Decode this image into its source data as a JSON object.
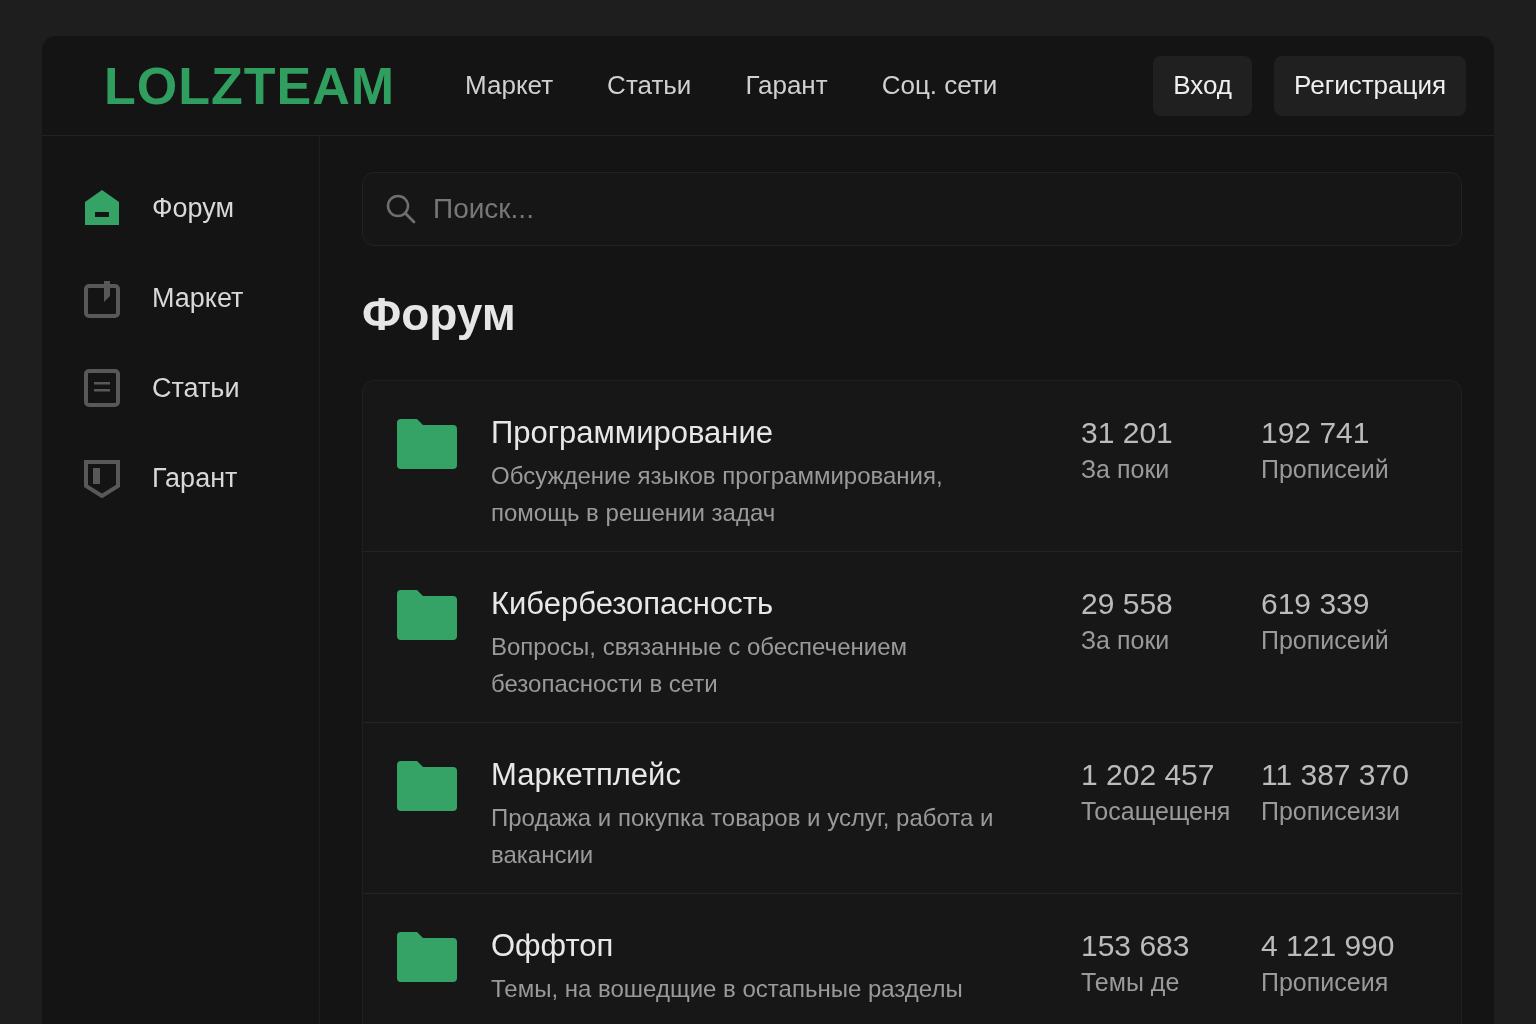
{
  "header": {
    "logo": "LOLZTEAM",
    "nav": [
      {
        "label": "Маркет"
      },
      {
        "label": "Статьи"
      },
      {
        "label": "Гарант"
      },
      {
        "label": "Соц. сети"
      }
    ],
    "buttons": [
      {
        "label": "Вход"
      },
      {
        "label": "Регистрация"
      }
    ]
  },
  "sidebar": {
    "items": [
      {
        "label": "Форум",
        "kind": "home",
        "selected": true
      },
      {
        "label": "Маркет",
        "kind": "clipboard",
        "selected": false
      },
      {
        "label": "Статьи",
        "kind": "document",
        "selected": false
      },
      {
        "label": "Гарант",
        "kind": "shield",
        "selected": false
      }
    ]
  },
  "search": {
    "placeholder": "Поиск..."
  },
  "page_title": "Форум",
  "forums": [
    {
      "title": "Программирование",
      "description": "Обсуждение языков программирования, помощь в решении задач",
      "stats": [
        {
          "value": "31 201",
          "label": "За поки"
        },
        {
          "value": "192 741",
          "label": "Прописеий"
        }
      ]
    },
    {
      "title": "Кибербезопасность",
      "description": "Вопросы, связанные с обеспечением безопасности в сети",
      "stats": [
        {
          "value": "29 558",
          "label": "За поки"
        },
        {
          "value": "619 339",
          "label": "Прописеий"
        }
      ]
    },
    {
      "title": "Маркетплейс",
      "description": "Продажа и покупка товаров и услуг, работа и вакансии",
      "stats": [
        {
          "value": "1 202 457",
          "label": "Тосащещеня"
        },
        {
          "value": "11 387 370",
          "label": "Прописеизи"
        }
      ]
    },
    {
      "title": "Оффтоп",
      "description": "Темы, на вошедщие в остапьные разделы",
      "stats": [
        {
          "value": "153 683",
          "label": "Темы де"
        },
        {
          "value": "4 121 990",
          "label": "Прописеия"
        }
      ]
    }
  ]
}
